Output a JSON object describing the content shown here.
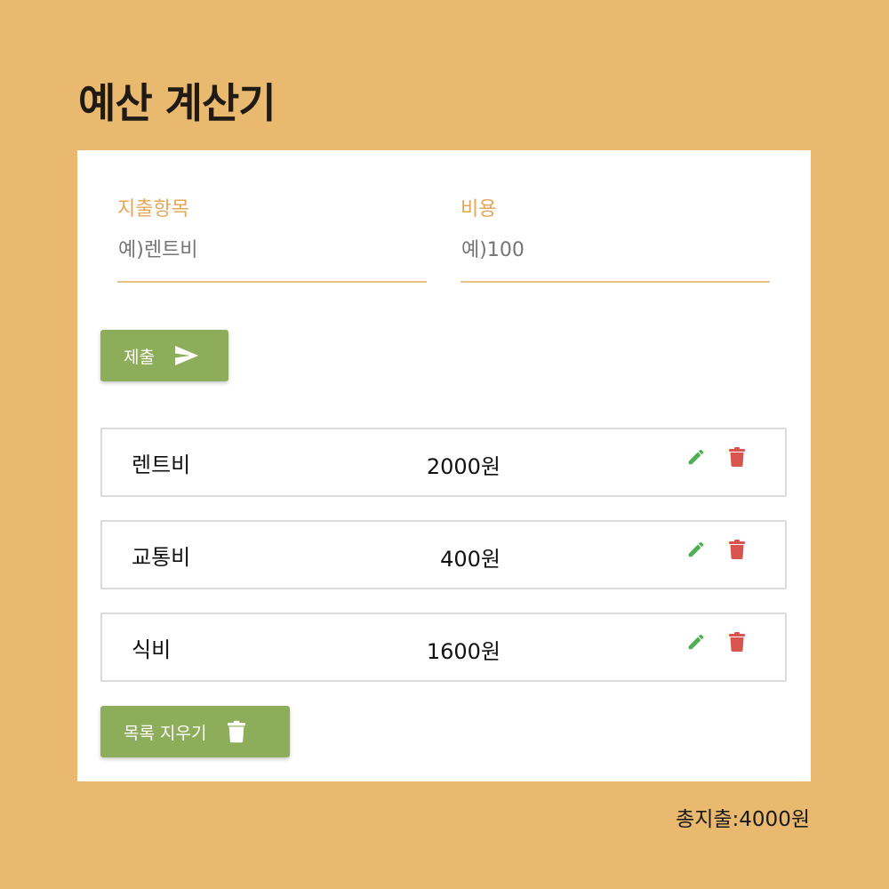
{
  "header": {
    "title": "예산 계산기"
  },
  "form": {
    "item_label": "지출항목",
    "item_placeholder": "예)렌트비",
    "cost_label": "비용",
    "cost_placeholder": "예)100",
    "submit_label": "제출"
  },
  "expenses": [
    {
      "name": "렌트비",
      "amount": "2000원"
    },
    {
      "name": "교통비",
      "amount": "400원"
    },
    {
      "name": "식비",
      "amount": "1600원"
    }
  ],
  "clear_label": "목록 지우기",
  "total_text": "총지출:4000원",
  "icons": {
    "submit": "send-icon",
    "edit": "pencil-icon",
    "delete": "trash-icon",
    "clear": "trash-icon"
  },
  "colors": {
    "background": "#e9b96f",
    "accent": "#e3a75a",
    "button": "#8ead5a",
    "edit": "#4caf50",
    "delete": "#d9534f"
  }
}
